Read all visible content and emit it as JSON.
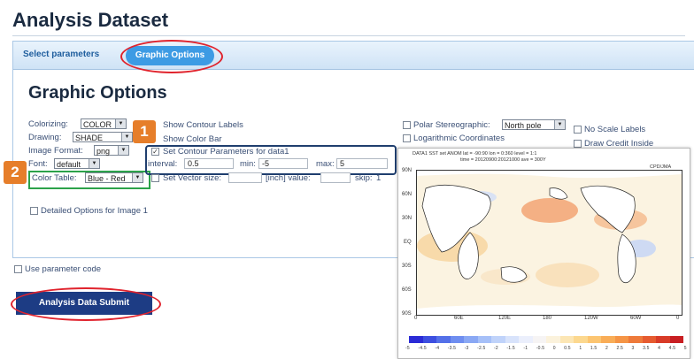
{
  "header": {
    "title": "Analysis Dataset"
  },
  "tabs": [
    {
      "label": "Select parameters",
      "active": false
    },
    {
      "label": "Graphic Options",
      "active": true
    }
  ],
  "section_title": "Graphic Options",
  "left_options": {
    "colorizing": {
      "label": "Colorizing:",
      "value": "COLOR"
    },
    "drawing": {
      "label": "Drawing:",
      "value": "SHADE"
    },
    "image_format": {
      "label": "Image Format:",
      "value": "png"
    },
    "font": {
      "label": "Font:",
      "value": "default"
    },
    "color_table": {
      "label": "Color Table:",
      "value": "Blue - Red"
    }
  },
  "middle_options": {
    "show_contour_labels": {
      "label": "Show Contour Labels",
      "checked": false
    },
    "show_color_bar": {
      "label": "Show Color Bar",
      "checked": false
    },
    "set_contour": {
      "label": "Set Contour Parameters for data1",
      "checked": true
    },
    "interval": {
      "label": "interval:",
      "value": "0.5"
    },
    "min": {
      "label": "min:",
      "value": "-5"
    },
    "max": {
      "label": "max:",
      "value": "5"
    },
    "set_vector": {
      "label": "Set Vector size:",
      "checked": false
    },
    "vector_inch": "[inch] value:",
    "skip": {
      "label": "skip:",
      "value": "1"
    }
  },
  "right_options": {
    "polar": {
      "label": "Polar Stereographic:",
      "value": "North pole",
      "checked": false
    },
    "log_coords": {
      "label": "Logarithmic Coordinates",
      "checked": false
    },
    "no_scale": {
      "label": "No Scale Labels",
      "checked": false
    },
    "draw_credit": {
      "label": "Draw Credit Inside",
      "checked": false
    }
  },
  "detailed_options": {
    "label": "Detailed Options for Image 1",
    "checked": false
  },
  "use_param_code": {
    "label": "Use parameter code",
    "checked": false
  },
  "submit_button": {
    "label": "Analysis Data Submit"
  },
  "badges": [
    "1",
    "2"
  ],
  "map": {
    "header_line1": "DATA1  SST  set  ANOM  lat = -90:90  lon = 0:360  level = 1:1",
    "header_line2": "time = 20120900:20121000  ave = 300Y",
    "credit": "CPD/JMA",
    "lat_labels": [
      "90N",
      "60N",
      "30N",
      "EQ",
      "30S",
      "60S",
      "90S"
    ],
    "lon_labels": [
      "0",
      "60E",
      "120E",
      "180",
      "120W",
      "60W",
      "0"
    ],
    "colorbar_labels": [
      "-5",
      "-4.5",
      "-4",
      "-3.5",
      "-3",
      "-2.5",
      "-2",
      "-1.5",
      "-1",
      "-0.5",
      "0",
      "0.5",
      "1",
      "1.5",
      "2",
      "2.5",
      "3",
      "3.5",
      "4",
      "4.5",
      "5"
    ],
    "colorbar_colors": [
      "#2b2bd6",
      "#3d4fe0",
      "#5470e8",
      "#6f8ef0",
      "#8aa8f4",
      "#a6c0f8",
      "#c0d3fa",
      "#d8e3fb",
      "#ebeffc",
      "#f6f4f4",
      "#fbf2dc",
      "#fce6b4",
      "#fcd88f",
      "#fcc571",
      "#f9ad57",
      "#f59546",
      "#ee7a3a",
      "#e65b30",
      "#d83b28",
      "#c81e22"
    ]
  }
}
